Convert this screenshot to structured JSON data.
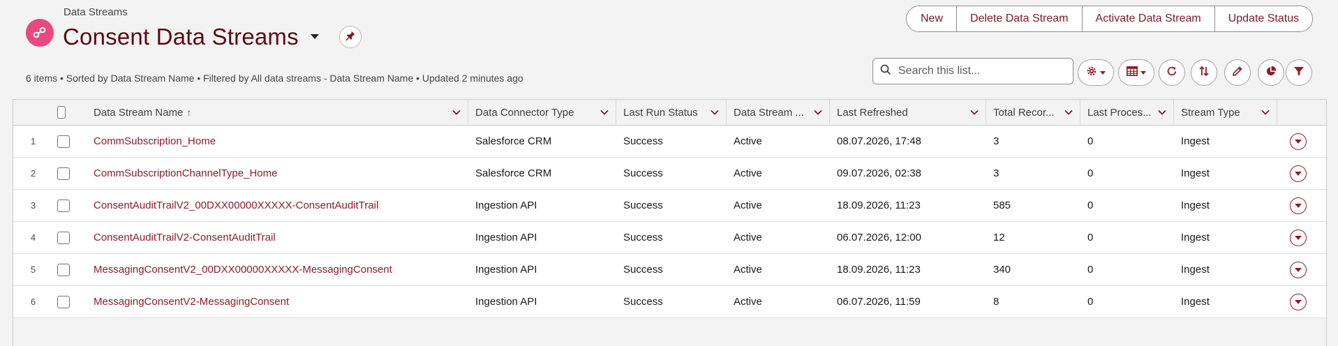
{
  "breadcrumb": "Data Streams",
  "page_title": "Consent Data Streams",
  "actions": {
    "new": "New",
    "delete": "Delete Data Stream",
    "activate": "Activate Data Stream",
    "update_status": "Update Status"
  },
  "list_info": "6 items • Sorted by Data Stream Name • Filtered by All data streams - Data Stream Name • Updated 2 minutes ago",
  "search": {
    "placeholder": "Search this list..."
  },
  "columns": [
    "Data Stream Name",
    "Data Connector Type",
    "Last Run Status",
    "Data Stream ...",
    "Last Refreshed",
    "Total Recor...",
    "Last Proces...",
    "Stream Type"
  ],
  "rows": [
    {
      "num": "1",
      "name": "CommSubscription_Home",
      "connector": "Salesforce CRM",
      "run_status": "Success",
      "stream_status": "Active",
      "last_refreshed": "08.07.2026, 17:48",
      "total_records": "3",
      "last_processed": "0",
      "stream_type": "Ingest"
    },
    {
      "num": "2",
      "name": "CommSubscriptionChannelType_Home",
      "connector": "Salesforce CRM",
      "run_status": "Success",
      "stream_status": "Active",
      "last_refreshed": "09.07.2026, 02:38",
      "total_records": "3",
      "last_processed": "0",
      "stream_type": "Ingest"
    },
    {
      "num": "3",
      "name": "ConsentAuditTrailV2_00DXX00000XXXXX-ConsentAuditTrail",
      "connector": "Ingestion API",
      "run_status": "Success",
      "stream_status": "Active",
      "last_refreshed": "18.09.2026, 11:23",
      "total_records": "585",
      "last_processed": "0",
      "stream_type": "Ingest"
    },
    {
      "num": "4",
      "name": "ConsentAuditTrailV2-ConsentAuditTrail",
      "connector": "Ingestion API",
      "run_status": "Success",
      "stream_status": "Active",
      "last_refreshed": "06.07.2026, 12:00",
      "total_records": "12",
      "last_processed": "0",
      "stream_type": "Ingest"
    },
    {
      "num": "5",
      "name": "MessagingConsentV2_00DXX00000XXXXX-MessagingConsent",
      "connector": "Ingestion API",
      "run_status": "Success",
      "stream_status": "Active",
      "last_refreshed": "18.09.2026, 11:23",
      "total_records": "340",
      "last_processed": "0",
      "stream_type": "Ingest"
    },
    {
      "num": "6",
      "name": "MessagingConsentV2-MessagingConsent",
      "connector": "Ingestion API",
      "run_status": "Success",
      "stream_status": "Active",
      "last_refreshed": "06.07.2026, 11:59",
      "total_records": "8",
      "last_processed": "0",
      "stream_type": "Ingest"
    }
  ],
  "colors": {
    "accent": "#8e1c28",
    "title": "#5a0b12",
    "app_icon": "#e8497f"
  },
  "icons": {
    "app": "data-stream-icon",
    "title_menu": "chevron-down-icon",
    "pin": "pin-icon",
    "search": "search-icon",
    "settings": "gear-icon",
    "display": "table-icon",
    "refresh": "refresh-icon",
    "sort": "sort-icon",
    "edit": "pencil-icon",
    "chart": "pie-chart-icon",
    "filter": "filter-icon"
  }
}
